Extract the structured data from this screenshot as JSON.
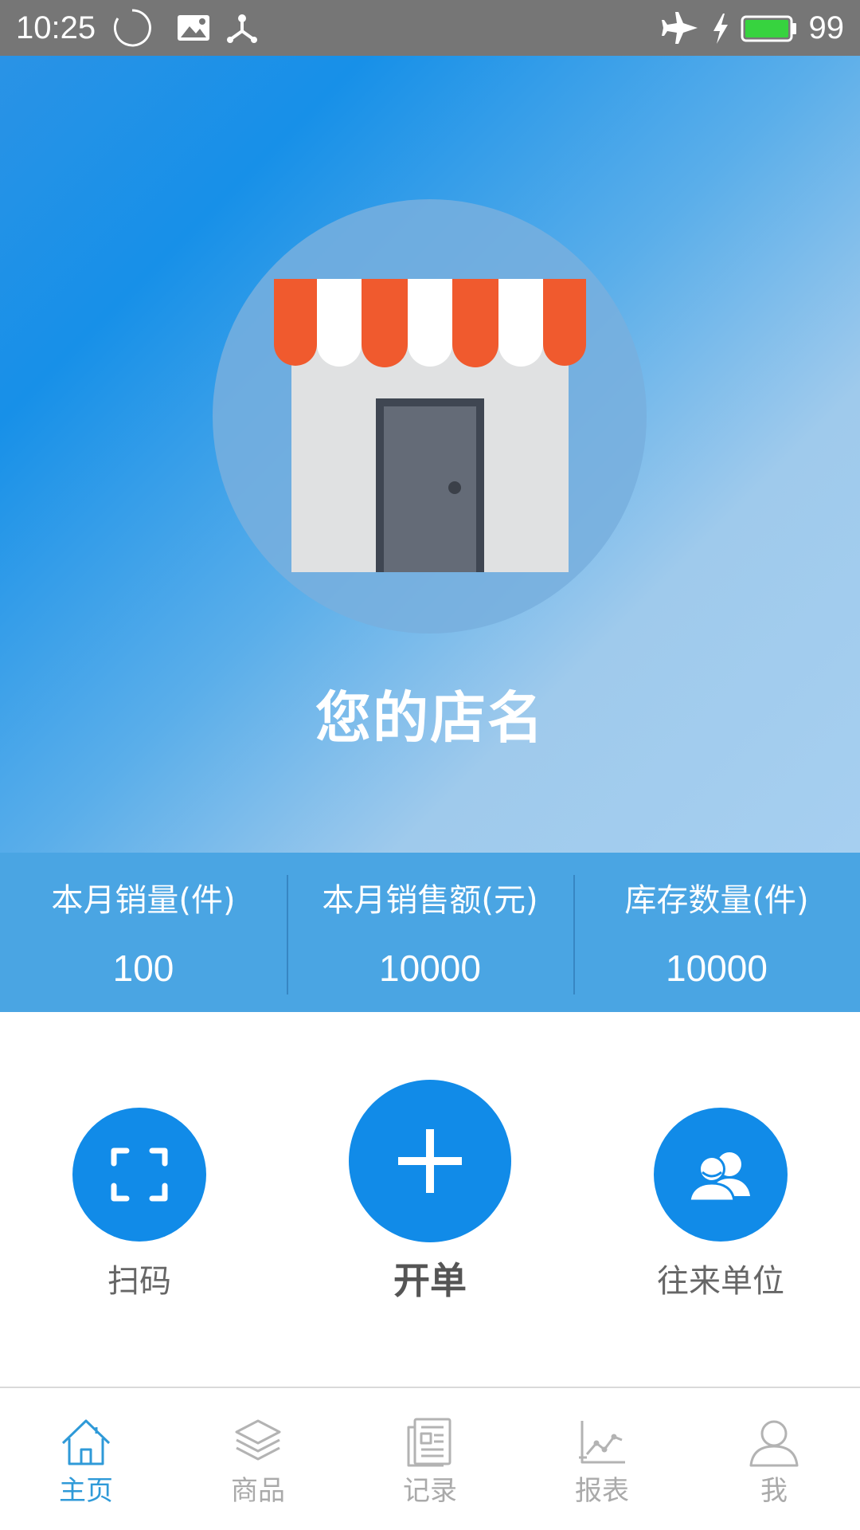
{
  "status_bar": {
    "time": "10:25",
    "battery": "99",
    "icons": [
      "loading-circle-icon",
      "image-notification-icon",
      "usb-icon",
      "airplane-mode-icon",
      "charging-icon",
      "battery-icon"
    ]
  },
  "hero": {
    "store_name": "您的店名",
    "image": "storefront-icon"
  },
  "stats": [
    {
      "label": "本月销量(件)",
      "value": "100"
    },
    {
      "label": "本月销售额(元)",
      "value": "10000"
    },
    {
      "label": "库存数量(件)",
      "value": "10000"
    }
  ],
  "actions": {
    "scan": {
      "label": "扫码",
      "icon": "scan-icon"
    },
    "new_order": {
      "label": "开单",
      "icon": "plus-icon"
    },
    "partners": {
      "label": "往来单位",
      "icon": "contacts-icon"
    }
  },
  "nav": {
    "items": [
      {
        "label": "主页",
        "icon": "home-icon",
        "active": true
      },
      {
        "label": "商品",
        "icon": "layers-icon",
        "active": false
      },
      {
        "label": "记录",
        "icon": "document-icon",
        "active": false
      },
      {
        "label": "报表",
        "icon": "chart-icon",
        "active": false
      },
      {
        "label": "我",
        "icon": "user-icon",
        "active": false
      }
    ]
  },
  "colors": {
    "primary": "#118be8",
    "status_bar": "#767676",
    "stats_bar": "#4aa5e3",
    "nav_active": "#2f9ad8",
    "nav_inactive": "#aaaaaa",
    "awning_red": "#f05a2e"
  }
}
